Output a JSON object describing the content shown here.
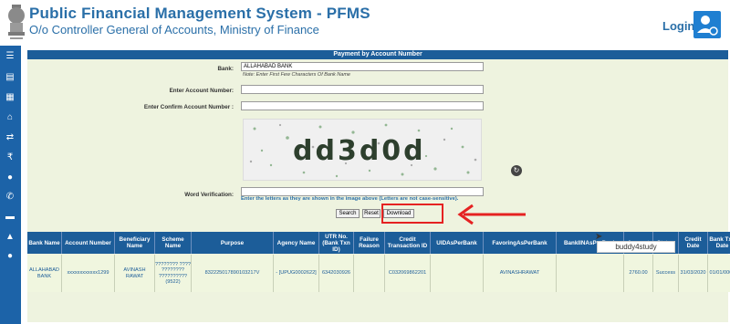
{
  "header": {
    "title": "Public Financial Management System - PFMS",
    "subtitle": "O/o Controller General of Accounts, Ministry of Finance",
    "login_label": "Login"
  },
  "sidebar": {
    "icons": [
      "menu-icon",
      "document-icon",
      "table-icon",
      "bank-icon",
      "transfer-icon",
      "rupee-icon",
      "location-icon",
      "phone-icon",
      "chat-icon",
      "warning-icon",
      "user-icon"
    ]
  },
  "form": {
    "heading": "Payment by Account Number",
    "bank_label": "Bank:",
    "bank_value": "ALLAHABAD BANK",
    "bank_note": "Note: Enter First Few Characters Of Bank Name",
    "account_label": "Enter Account Number:",
    "account_value": "",
    "confirm_label": "Enter Confirm Account Number :",
    "confirm_value": "",
    "captcha_text": "dd3d0d",
    "word_label": "Word Verification:",
    "word_value": "",
    "word_hint": "Enter the letters as they are shown in the image above (Letters are not case-sensitive).",
    "search_label": "Search",
    "reset_label": "Reset",
    "download_label": "Download"
  },
  "table": {
    "columns": [
      "Bank Name",
      "Account Number",
      "Beneficiary Name",
      "Scheme Name",
      "Purpose",
      "Agency Name",
      "UTR No. (Bank Txn ID)",
      "Failure Reason",
      "Credit Transaction ID",
      "UIDAsPerBank",
      "FavoringAsPerBank",
      "BankIINAsPerBank",
      "Amount",
      "Status",
      "Credit Date",
      "Bank Txn Date"
    ],
    "rows": [
      [
        "ALLAHABAD BANK",
        "xxxxxxxxxxxx1299",
        "AVINASH RAWAT",
        "???????? ???? ???????? ?????????? (9522)",
        "832225017890103217V",
        "- [UPUG0002622]",
        "6342030926",
        "",
        "C032069862201",
        "",
        "AVINASHRAWAT",
        "",
        "2760.00",
        "Success",
        "31/03/2020",
        "01/01/0001"
      ]
    ]
  },
  "watermark": "buddy4study",
  "colors": {
    "brand_blue": "#1c5d99",
    "title_blue": "#2a6fa8",
    "highlight_red": "#e52222"
  }
}
